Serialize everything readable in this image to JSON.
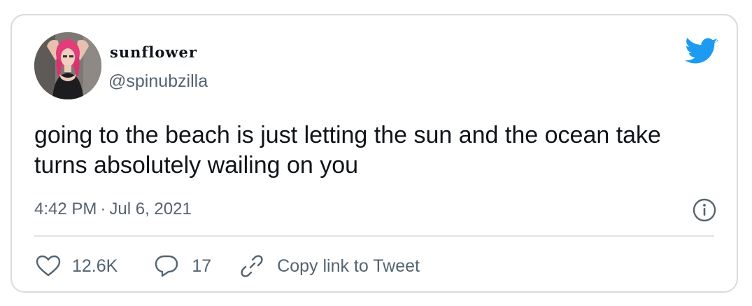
{
  "author": {
    "display_name": "sunflower",
    "handle": "@spinubzilla"
  },
  "tweet": {
    "text": "going to the beach is just letting the sun and the ocean take turns absolutely wailing on you",
    "time": "4:42 PM",
    "separator": "·",
    "date": "Jul 6, 2021"
  },
  "actions": {
    "likes": "12.6K",
    "replies": "17",
    "copy_link_label": "Copy link to Tweet"
  },
  "icons": {
    "logo": "twitter-bird-icon",
    "info": "info-icon",
    "like": "heart-icon",
    "reply": "speech-bubble-icon",
    "copy": "link-icon"
  },
  "colors": {
    "brand": "#1d9bf0",
    "text": "#0f1419",
    "secondary_text": "#536471",
    "border": "#d7dbdf"
  }
}
